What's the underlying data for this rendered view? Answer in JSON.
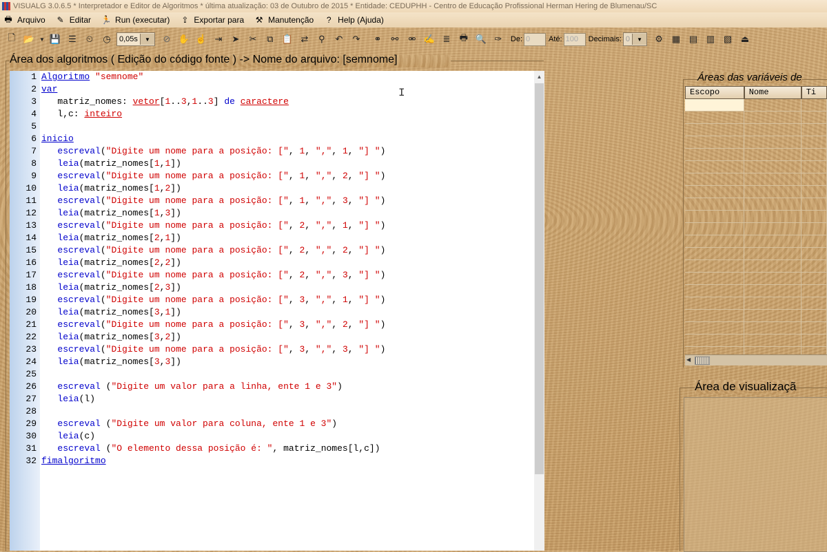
{
  "window": {
    "title": "VISUALG 3.0.6.5 * Interpretador e Editor de Algoritmos * última atualização: 03 de Outubro de 2015 * Entidade: CEDUPHH - Centro de Educação Profissional Herman Hering de Blumenau/SC"
  },
  "menu": [
    {
      "label": "Arquivo",
      "icon": "printer-icon",
      "glyph": "🖶"
    },
    {
      "label": "Editar",
      "icon": "edit-icon",
      "glyph": "✎"
    },
    {
      "label": "Run (executar)",
      "icon": "run-icon",
      "glyph": "🏃"
    },
    {
      "label": "Exportar para",
      "icon": "export-icon",
      "glyph": "⇪"
    },
    {
      "label": "Manutenção",
      "icon": "tools-icon",
      "glyph": "⚒"
    },
    {
      "label": "Help (Ajuda)",
      "icon": "help-icon",
      "glyph": "?"
    }
  ],
  "toolbar": {
    "speed_value": "0,05s",
    "de_label": "De:",
    "de_value": "0",
    "ate_label": "Até:",
    "ate_value": "100",
    "decimais_label": "Decimais:",
    "decimais_value": "0"
  },
  "code_panel": {
    "title": "Área dos algoritmos ( Edição do código fonte ) -> Nome do arquivo: [semnome]"
  },
  "code_lines": [
    "1",
    "2",
    "3",
    "4",
    "5",
    "6",
    "7",
    "8",
    "9",
    "10",
    "11",
    "12",
    "13",
    "14",
    "15",
    "16",
    "17",
    "18",
    "19",
    "20",
    "21",
    "22",
    "23",
    "24",
    "25",
    "26",
    "27",
    "28",
    "29",
    "30",
    "31",
    "32"
  ],
  "variables_panel": {
    "title": "Áreas das variáveis de",
    "columns": [
      "Escopo",
      "Nome",
      "Ti"
    ]
  },
  "visualization_panel": {
    "title": "Área de visualizaçã"
  },
  "colors": {
    "keyword": "#0000cc",
    "string": "#d00000",
    "selected_cell": "#fff4d8"
  }
}
